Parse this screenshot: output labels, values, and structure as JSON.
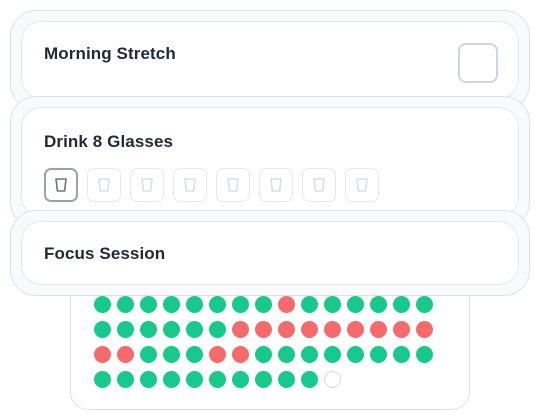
{
  "habits": [
    {
      "title": "Morning Stretch",
      "checked": false
    },
    {
      "title": "Drink 8 Glasses",
      "glasses_total": 8,
      "glasses_filled": 1
    },
    {
      "title": "Focus Session"
    }
  ],
  "colors": {
    "done": "#17c98a",
    "missed": "#f56b6b",
    "empty": "#ffffff"
  },
  "dot_grid": {
    "columns": 15,
    "days": [
      "done",
      "done",
      "done",
      "done",
      "done",
      "done",
      "done",
      "done",
      "missed",
      "done",
      "done",
      "done",
      "done",
      "done",
      "done",
      "done",
      "done",
      "done",
      "done",
      "done",
      "done",
      "missed",
      "missed",
      "missed",
      "missed",
      "missed",
      "missed",
      "missed",
      "missed",
      "missed",
      "missed",
      "missed",
      "done",
      "done",
      "done",
      "missed",
      "missed",
      "done",
      "done",
      "done",
      "done",
      "done",
      "done",
      "done",
      "done",
      "done",
      "done",
      "done",
      "done",
      "done",
      "done",
      "done",
      "done",
      "done",
      "done",
      "empty"
    ]
  }
}
